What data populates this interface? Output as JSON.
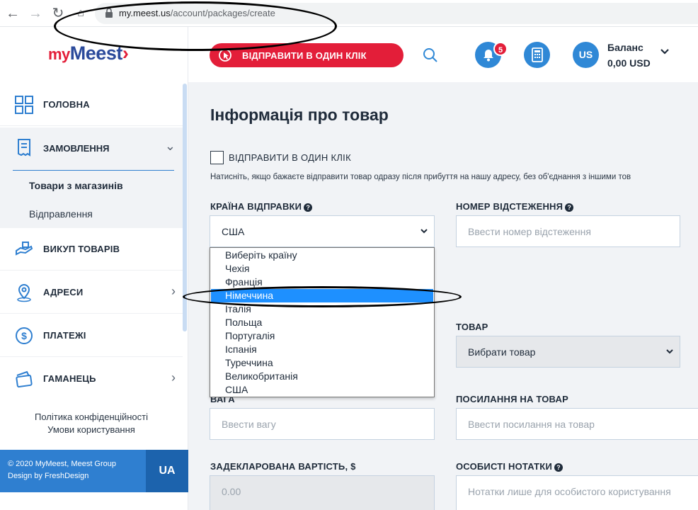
{
  "browser": {
    "url_host": "my.meest.us",
    "url_path": "/account/packages/create"
  },
  "logo": {
    "my": "my",
    "meest": "Meest"
  },
  "sidebar": {
    "items": [
      {
        "label": "ГОЛОВНА"
      },
      {
        "label": "ЗАМОВЛЕННЯ"
      },
      {
        "label": "ВИКУП ТОВАРІВ"
      },
      {
        "label": "АДРЕСИ"
      },
      {
        "label": "ПЛАТЕЖІ"
      },
      {
        "label": "ГАМАНЕЦЬ"
      }
    ],
    "sub_items": [
      "Товари з магазинів",
      "Відправлення"
    ],
    "footer_links": [
      "Політика конфіденційності",
      "Умови користування"
    ],
    "copyright": [
      "© 2020 MyMeest, Meest Group",
      "Design by FreshDesign"
    ],
    "language": "UA"
  },
  "header": {
    "cta_label": "ВІДПРАВИТИ В ОДИН КЛІК",
    "notification_count": "5",
    "avatar_initials": "US",
    "balance_label": "Баланс",
    "balance_value": "0,00 USD"
  },
  "form": {
    "title": "Інформація про товар",
    "one_click_label": "ВІДПРАВИТИ В ОДИН КЛІК",
    "one_click_hint": "Натисніть, якщо бажаєте відправити товар одразу після прибуття на нашу адресу, без об'єднання з іншими тов",
    "country_label": "КРАЇНА ВІДПРАВКИ",
    "country_value": "США",
    "tracking_label": "НОМЕР ВІДСТЕЖЕННЯ",
    "tracking_placeholder": "Ввести номер відстеження",
    "product_label": "ТОВАР",
    "product_value": "Вибрати товар",
    "weight_label": "ВАГА",
    "weight_placeholder": "Ввести вагу",
    "link_label": "ПОСИЛАННЯ НА ТОВАР",
    "link_placeholder": "Ввести посилання на товар",
    "declared_label": "ЗАДЕКЛАРОВАНА ВАРТІСТЬ, $",
    "declared_placeholder": "0.00",
    "notes_label": "ОСОБИСТІ НОТАТКИ",
    "notes_placeholder": "Нотатки лише для особистого користування"
  },
  "country_dropdown": {
    "options": [
      "Виберіть країну",
      "Чехія",
      "Франція",
      "Німеччина",
      "Італія",
      "Польща",
      "Португалія",
      "Іспанія",
      "Туреччина",
      "Великобританія",
      "США"
    ],
    "highlighted": "Німеччина"
  },
  "colors": {
    "brand_red": "#e31e39",
    "brand_blue": "#2f7fd0",
    "highlight": "#1e90ff"
  }
}
